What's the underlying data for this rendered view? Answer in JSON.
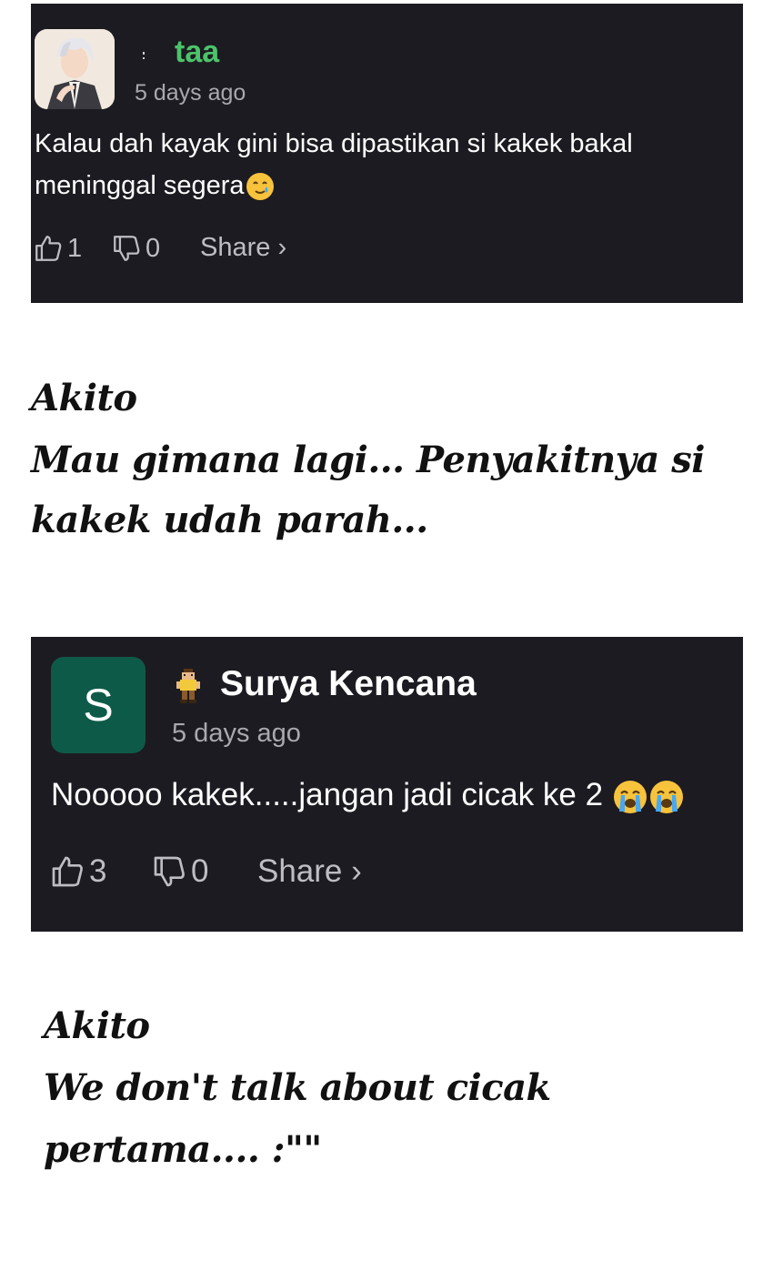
{
  "comments": [
    {
      "username": "taa",
      "username_color": "#4cc36a",
      "timestamp": "5 days ago",
      "text_line1": "Kalau dah kayak gini bisa dipastikan si kakek bakal",
      "text_line2": "meninggal segera",
      "emoji": "smiling-face-with-tear",
      "likes": "1",
      "dislikes": "0",
      "share_label": "Share ›"
    },
    {
      "username": "Surya Kencana",
      "username_color": "#ffffff",
      "avatar_letter": "S",
      "avatar_color": "#0e5a48",
      "timestamp": "5 days ago",
      "text": "Nooooo kakek.....jangan jadi cicak ke 2",
      "emoji": "loudly-crying-face",
      "likes": "3",
      "dislikes": "0",
      "share_label": "Share ›"
    }
  ],
  "replies": [
    {
      "author": "Akito",
      "line1": "Mau gimana lagi... Penyakitnya si",
      "line2": "kakek udah parah..."
    },
    {
      "author": "Akito",
      "line1": "We don't talk about cicak",
      "line2": "pertama.... :\"\""
    }
  ],
  "colors": {
    "card_background": "#1c1b21",
    "secondary_text": "#a8a8ae",
    "page_background": "#ffffff"
  }
}
